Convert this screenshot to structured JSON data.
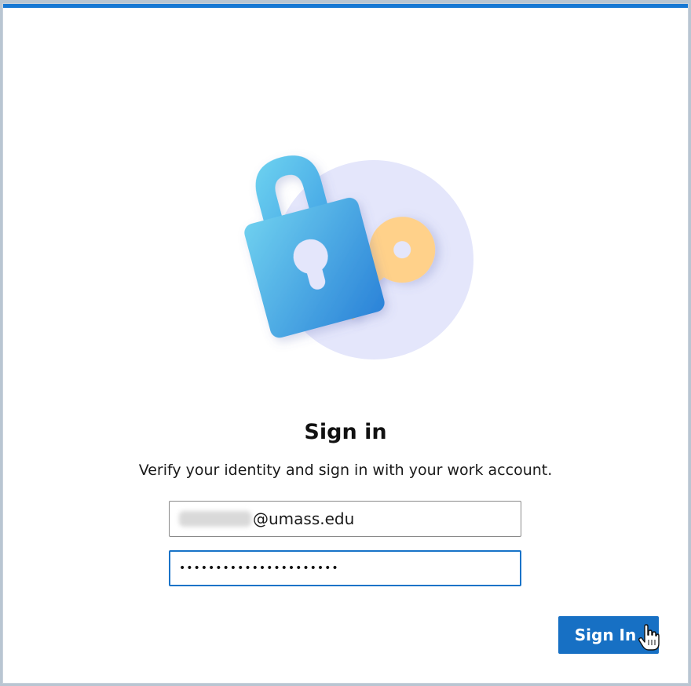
{
  "dialog": {
    "title": "Sign in",
    "subtitle": "Verify your identity and sign in with your work account."
  },
  "form": {
    "email_domain": "@umass.edu",
    "password_masked": "••••••••••••••••••••••"
  },
  "buttons": {
    "sign_in_label": "Sign In"
  },
  "icons": {
    "illustration": "lock-and-key-icon",
    "pointer": "hand-cursor-icon"
  },
  "colors": {
    "accent": "#1770c4",
    "top_bar": "#1678d4",
    "lock_gradient_start": "#6fd0ef",
    "lock_gradient_end": "#2d86da",
    "key": "#ffd18a",
    "circle": "#e4e6fb"
  }
}
